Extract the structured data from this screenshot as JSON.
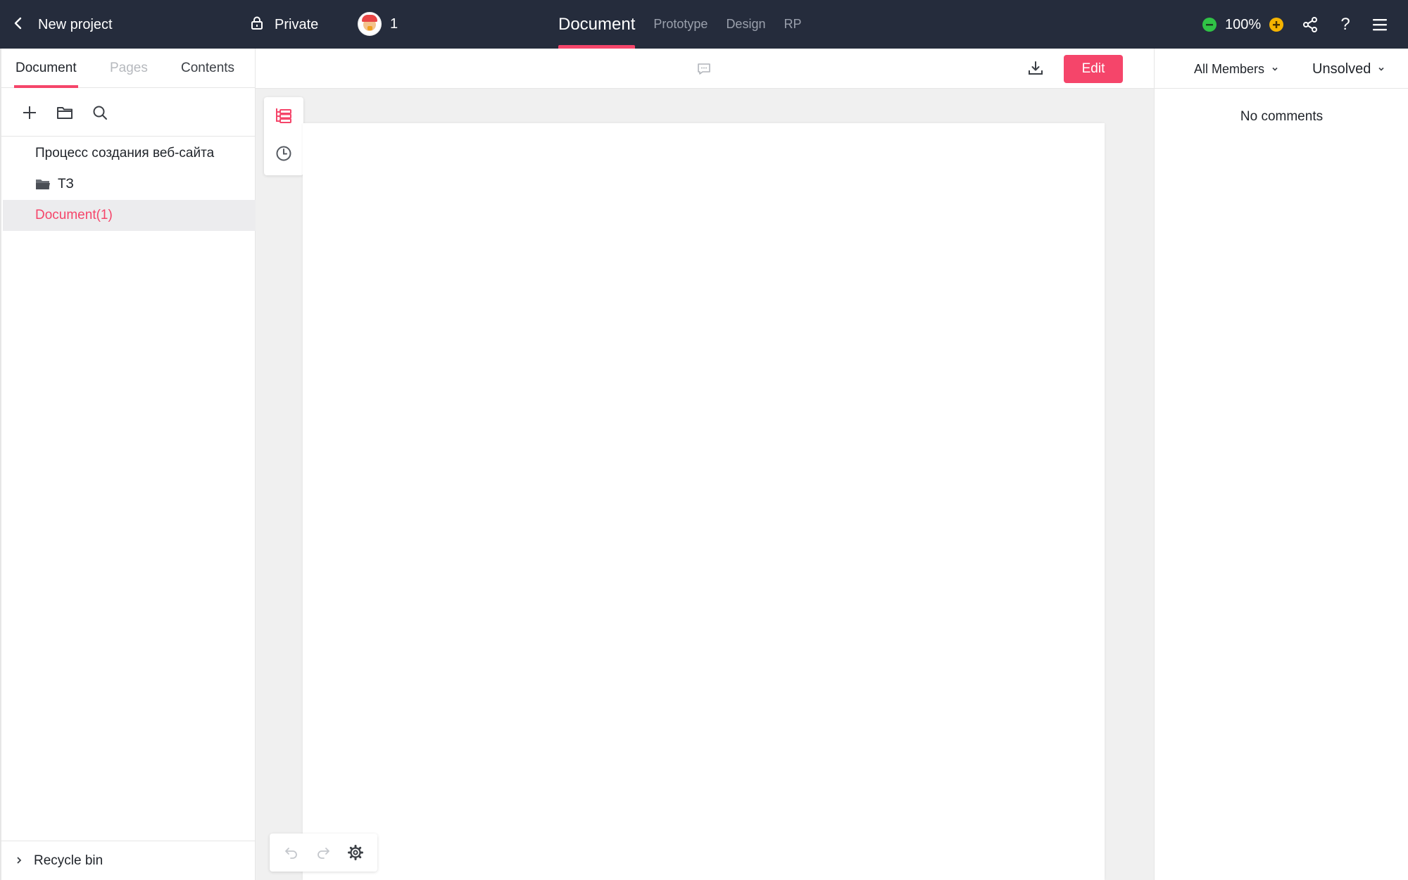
{
  "header": {
    "back_label": "New project",
    "privacy_label": "Private",
    "collaborator_count": "1",
    "tabs": [
      {
        "label": "Document",
        "active": true
      },
      {
        "label": "Prototype",
        "active": false
      },
      {
        "label": "Design",
        "active": false
      },
      {
        "label": "RP",
        "active": false
      }
    ],
    "zoom_value": "100%",
    "help_label": "?"
  },
  "sidebar": {
    "tabs": [
      {
        "label": "Document",
        "state": "active"
      },
      {
        "label": "Pages",
        "state": "disabled"
      },
      {
        "label": "Contents",
        "state": "normal"
      }
    ],
    "tools": [
      "plus-icon",
      "folder-icon",
      "search-icon"
    ],
    "tree": [
      {
        "label": "Процесс создания веб-сайта",
        "type": "document",
        "selected": false
      },
      {
        "label": "ТЗ",
        "type": "folder",
        "selected": false
      },
      {
        "label": "Document(1)",
        "type": "document",
        "selected": true
      }
    ],
    "recycle_label": "Recycle bin"
  },
  "toolbar": {
    "edit_label": "Edit"
  },
  "comments": {
    "members_filter": "All Members",
    "status_filter": "Unsolved",
    "empty_text": "No comments"
  },
  "colors": {
    "accent": "#f5456a",
    "header_bg": "#252c3c",
    "zoom_minus": "#30c346",
    "zoom_plus": "#f5b400"
  }
}
